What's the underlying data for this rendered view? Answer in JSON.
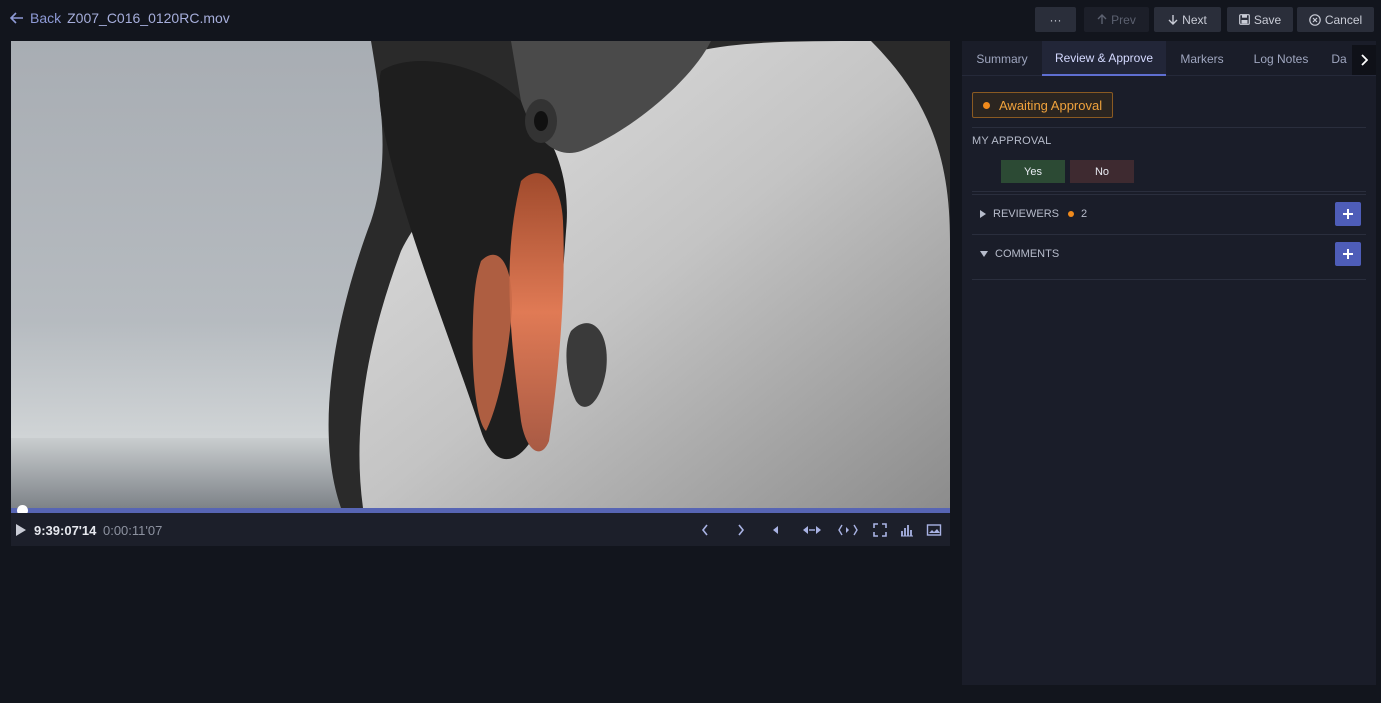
{
  "header": {
    "back_label": "Back",
    "filename": "Z007_C016_0120RC.mov",
    "more_label": "···",
    "prev_label": "Prev",
    "next_label": "Next",
    "save_label": "Save",
    "cancel_label": "Cancel"
  },
  "player": {
    "timecode": "9:39:07'14",
    "duration": "0:00:11'07",
    "playhead_fraction": 0.006
  },
  "panel": {
    "tabs": [
      {
        "label": "Summary"
      },
      {
        "label": "Review & Approve"
      },
      {
        "label": "Markers"
      },
      {
        "label": "Log Notes"
      },
      {
        "label": "Da"
      }
    ],
    "active_tab": "Review & Approve",
    "status_label": "Awaiting Approval",
    "my_approval_label": "MY APPROVAL",
    "yes_label": "Yes",
    "no_label": "No",
    "reviewers_label": "REVIEWERS",
    "reviewers_count": "2",
    "comments_label": "COMMENTS"
  },
  "colors": {
    "accent": "#5765b4",
    "status_orange": "#f08a1c",
    "yes_green": "#2c4a34",
    "no_red": "#3e2a30"
  }
}
